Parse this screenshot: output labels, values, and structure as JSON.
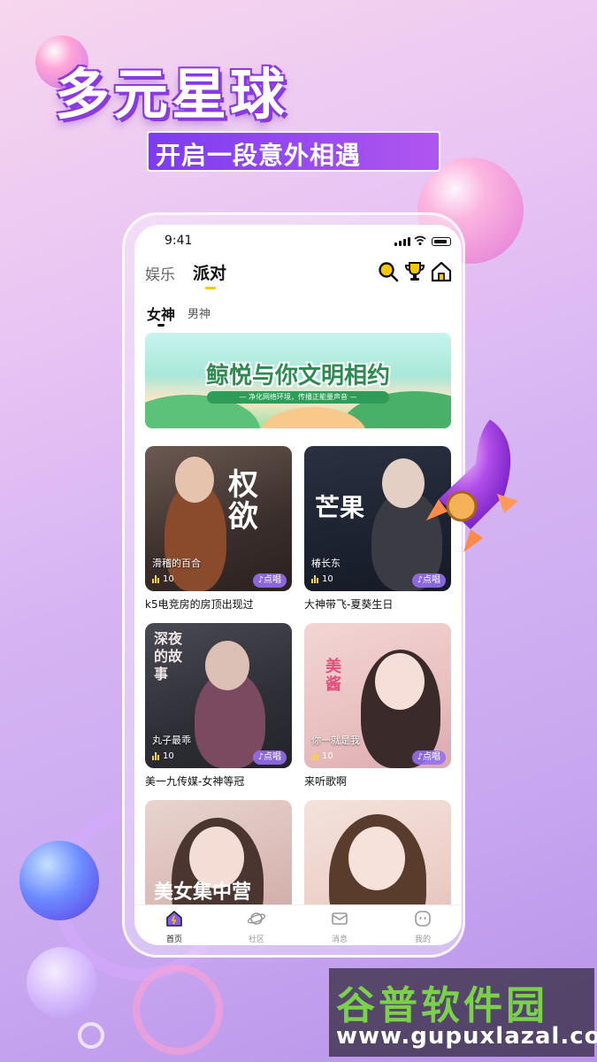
{
  "hero": {
    "title": "多元星球",
    "subtitle": "开启一段意外相遇"
  },
  "status_bar": {
    "time": "9:41"
  },
  "top_nav": {
    "tabs": [
      {
        "label": "娱乐",
        "active": false
      },
      {
        "label": "派对",
        "active": true
      }
    ],
    "icons": [
      "search-icon",
      "trophy-icon",
      "home-icon"
    ]
  },
  "sub_tabs": [
    {
      "label": "女神",
      "active": true
    },
    {
      "label": "男神",
      "active": false
    }
  ],
  "banner": {
    "title": "鲸悦与你文明相约",
    "subtitle": "— 净化网络环境，传播正能量声音 —"
  },
  "rooms": [
    {
      "overlay_name": "滑稽的百合",
      "listeners": "10",
      "action": "点唱",
      "caption": "k5电竞房的房顶出现过",
      "art_text": "权欲"
    },
    {
      "overlay_name": "椿长东",
      "listeners": "10",
      "action": "点唱",
      "caption": "大神带飞-夏葵生日",
      "art_text": "芒果"
    },
    {
      "overlay_name": "丸子最乖",
      "listeners": "10",
      "action": "点唱",
      "caption": "美一九传媒-女神等冠",
      "art_text": "深夜的故事"
    },
    {
      "overlay_name": "你一就是我",
      "listeners": "10",
      "action": "点唱",
      "caption": "来听歌啊",
      "art_text": "美酱"
    },
    {
      "overlay_name": "",
      "listeners": "",
      "action": "",
      "caption": "",
      "art_text": "美女集中营"
    },
    {
      "overlay_name": "",
      "listeners": "",
      "action": "",
      "caption": "",
      "art_text": ""
    }
  ],
  "bottom_nav": [
    {
      "label": "首页",
      "icon": "home-planet-icon",
      "active": true
    },
    {
      "label": "社区",
      "icon": "planet-icon",
      "active": false
    },
    {
      "label": "消息",
      "icon": "mail-icon",
      "active": false
    },
    {
      "label": "我的",
      "icon": "profile-face-icon",
      "active": false
    }
  ],
  "watermark": {
    "title": "谷普软件园",
    "url": "www.gupuxlazal.com"
  },
  "colors": {
    "accent_purple": "#8a3ae0",
    "tab_indicator": "#f6c700",
    "request_badge": "#966ef0",
    "banner_green": "#2d8b52"
  }
}
